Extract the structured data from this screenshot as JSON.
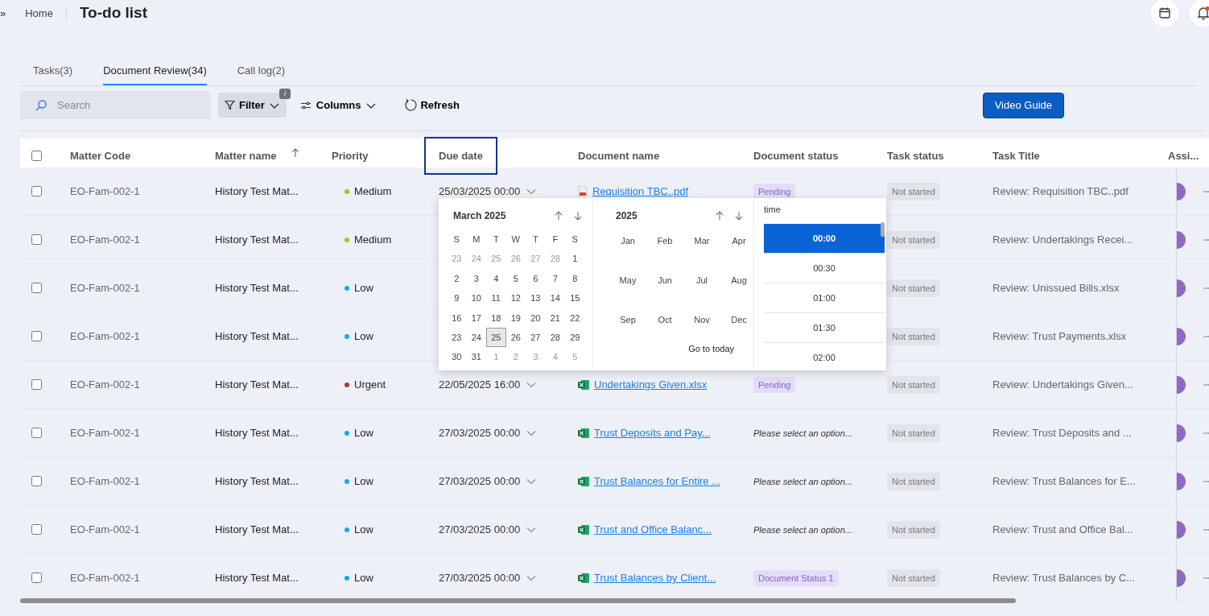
{
  "breadcrumb": {
    "expand": "»",
    "home": "Home",
    "title": "To-do list"
  },
  "tabs": [
    {
      "label": "Tasks(3)",
      "selected": false
    },
    {
      "label": "Document Review(34)",
      "selected": true
    },
    {
      "label": "Call log(2)",
      "selected": false
    }
  ],
  "toolbar": {
    "search": {
      "placeholder": "Search"
    },
    "filter": "Filter",
    "filter_badge": "i",
    "columns": "Columns",
    "refresh": "Refresh",
    "video_guide": "Video Guide"
  },
  "table": {
    "select_all": {
      "checked": false
    },
    "columns": [
      {
        "label": "Matter Code",
        "sorted": false,
        "highlighted": false
      },
      {
        "label": "Matter name",
        "sorted": true,
        "highlighted": false
      },
      {
        "label": "Priority",
        "sorted": false,
        "highlighted": false
      },
      {
        "label": "Due date",
        "sorted": false,
        "highlighted": true
      },
      {
        "label": "Document name",
        "sorted": false,
        "highlighted": false
      },
      {
        "label": "Document status",
        "sorted": false,
        "highlighted": false
      },
      {
        "label": "Task status",
        "sorted": false,
        "highlighted": false
      },
      {
        "label": "Task Title",
        "sorted": false,
        "highlighted": false
      },
      {
        "label": "Assi...",
        "sorted": false,
        "highlighted": false
      }
    ],
    "rows": [
      {
        "checked": false,
        "matter_code": "EO-Fam-002-1",
        "matter_name": "History Test Mat...",
        "priority": "Medium",
        "color": "#a3c614",
        "due_date": "25/03/2025 00:00",
        "document": {
          "name": "Requisition TBC..pdf",
          "kind": "pdf"
        },
        "document_status": {
          "kind": "badge",
          "text": "Pending"
        },
        "task_status": "Not started",
        "task_title": "Review: Requisition TBC..pdf"
      },
      {
        "checked": false,
        "matter_code": "EO-Fam-002-1",
        "matter_name": "History Test Mat...",
        "priority": "Medium",
        "color": "#a3c614",
        "task_status": "Not started",
        "task_title": "Review: Undertakings Recei..."
      },
      {
        "checked": false,
        "matter_code": "EO-Fam-002-1",
        "matter_name": "History Test Mat...",
        "priority": "Low",
        "color": "#10aaf0",
        "task_status": "Not started",
        "task_title": "Review: Unissued Bills.xlsx"
      },
      {
        "checked": false,
        "matter_code": "EO-Fam-002-1",
        "matter_name": "History Test Mat...",
        "priority": "Low",
        "color": "#10aaf0",
        "task_status": "Not started",
        "task_title": "Review: Trust Payments.xlsx"
      },
      {
        "checked": false,
        "matter_code": "EO-Fam-002-1",
        "matter_name": "History Test Mat...",
        "priority": "Urgent",
        "color": "#b83232",
        "due_date": "22/05/2025 16:00",
        "document": {
          "name": "Undertakings Given.xlsx",
          "kind": "xlsx"
        },
        "document_status": {
          "kind": "badge",
          "text": "Pending"
        },
        "task_status": "Not started",
        "task_title": "Review: Undertakings Given..."
      },
      {
        "checked": false,
        "matter_code": "EO-Fam-002-1",
        "matter_name": "History Test Mat...",
        "priority": "Low",
        "color": "#10aaf0",
        "due_date": "27/03/2025 00:00",
        "document": {
          "name": "Trust Deposits and Pay...",
          "kind": "xlsx"
        },
        "document_status": {
          "kind": "placeholder",
          "text": "Please select an option..."
        },
        "task_status": "Not started",
        "task_title": "Review: Trust Deposits and ..."
      },
      {
        "checked": false,
        "matter_code": "EO-Fam-002-1",
        "matter_name": "History Test Mat...",
        "priority": "Low",
        "color": "#10aaf0",
        "due_date": "27/03/2025 00:00",
        "document": {
          "name": "Trust Balances for Entire ...",
          "kind": "xlsx"
        },
        "document_status": {
          "kind": "placeholder",
          "text": "Please select an option..."
        },
        "task_status": "Not started",
        "task_title": "Review: Trust Balances for E..."
      },
      {
        "checked": false,
        "matter_code": "EO-Fam-002-1",
        "matter_name": "History Test Mat...",
        "priority": "Low",
        "color": "#10aaf0",
        "due_date": "27/03/2025 00:00",
        "document": {
          "name": "Trust and Office Balanc...",
          "kind": "xlsx"
        },
        "document_status": {
          "kind": "placeholder",
          "text": "Please select an option..."
        },
        "task_status": "Not started",
        "task_title": "Review: Trust and Office Bal..."
      },
      {
        "checked": false,
        "matter_code": "EO-Fam-002-1",
        "matter_name": "History Test Mat...",
        "priority": "Low",
        "color": "#10aaf0",
        "due_date": "27/03/2025 00:00",
        "document": {
          "name": "Trust Balances by Client...",
          "kind": "xlsx"
        },
        "document_status": {
          "kind": "badge",
          "text": "Document Status 1"
        },
        "task_status": "Not started",
        "task_title": "Review: Trust Balances by C..."
      }
    ]
  },
  "date_picker": {
    "month_title": "March 2025",
    "weekdays": [
      "S",
      "M",
      "T",
      "W",
      "T",
      "F",
      "S"
    ],
    "days": [
      {
        "d": "23",
        "outside": true,
        "selected": false
      },
      {
        "d": "24",
        "outside": true,
        "selected": false
      },
      {
        "d": "25",
        "outside": true,
        "selected": false
      },
      {
        "d": "26",
        "outside": true,
        "selected": false
      },
      {
        "d": "27",
        "outside": true,
        "selected": false
      },
      {
        "d": "28",
        "outside": true,
        "selected": false
      },
      {
        "d": "1",
        "outside": false,
        "selected": false
      },
      {
        "d": "2",
        "outside": false,
        "selected": false
      },
      {
        "d": "3",
        "outside": false,
        "selected": false
      },
      {
        "d": "4",
        "outside": false,
        "selected": false
      },
      {
        "d": "5",
        "outside": false,
        "selected": false
      },
      {
        "d": "6",
        "outside": false,
        "selected": false
      },
      {
        "d": "7",
        "outside": false,
        "selected": false
      },
      {
        "d": "8",
        "outside": false,
        "selected": false
      },
      {
        "d": "9",
        "outside": false,
        "selected": false
      },
      {
        "d": "10",
        "outside": false,
        "selected": false
      },
      {
        "d": "11",
        "outside": false,
        "selected": false
      },
      {
        "d": "12",
        "outside": false,
        "selected": false
      },
      {
        "d": "13",
        "outside": false,
        "selected": false
      },
      {
        "d": "14",
        "outside": false,
        "selected": false
      },
      {
        "d": "15",
        "outside": false,
        "selected": false
      },
      {
        "d": "16",
        "outside": false,
        "selected": false
      },
      {
        "d": "17",
        "outside": false,
        "selected": false
      },
      {
        "d": "18",
        "outside": false,
        "selected": false
      },
      {
        "d": "19",
        "outside": false,
        "selected": false
      },
      {
        "d": "20",
        "outside": false,
        "selected": false
      },
      {
        "d": "21",
        "outside": false,
        "selected": false
      },
      {
        "d": "22",
        "outside": false,
        "selected": false
      },
      {
        "d": "23",
        "outside": false,
        "selected": false
      },
      {
        "d": "24",
        "outside": false,
        "selected": false
      },
      {
        "d": "25",
        "outside": false,
        "selected": true
      },
      {
        "d": "26",
        "outside": false,
        "selected": false
      },
      {
        "d": "27",
        "outside": false,
        "selected": false
      },
      {
        "d": "28",
        "outside": false,
        "selected": false
      },
      {
        "d": "29",
        "outside": false,
        "selected": false
      },
      {
        "d": "30",
        "outside": false,
        "selected": false
      },
      {
        "d": "31",
        "outside": false,
        "selected": false
      },
      {
        "d": "1",
        "outside": true,
        "selected": false
      },
      {
        "d": "2",
        "outside": true,
        "selected": false
      },
      {
        "d": "3",
        "outside": true,
        "selected": false
      },
      {
        "d": "4",
        "outside": true,
        "selected": false
      },
      {
        "d": "5",
        "outside": true,
        "selected": false
      }
    ],
    "year_title": "2025",
    "months": [
      "Jan",
      "Feb",
      "Mar",
      "Apr",
      "May",
      "Jun",
      "Jul",
      "Aug",
      "Sep",
      "Oct",
      "Nov",
      "Dec"
    ],
    "go_to_today": "Go to today",
    "time_title": "time",
    "times": [
      {
        "t": "00:00",
        "selected": true
      },
      {
        "t": "00:30",
        "selected": false
      },
      {
        "t": "01:00",
        "selected": false
      },
      {
        "t": "01:30",
        "selected": false
      },
      {
        "t": "02:00",
        "selected": false
      }
    ]
  }
}
